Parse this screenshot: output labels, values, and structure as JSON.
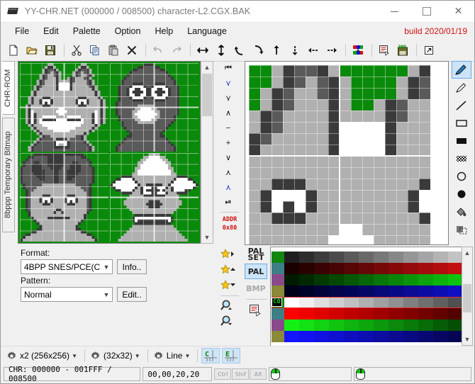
{
  "window": {
    "title": "YY-CHR.NET (000000 / 008500) character-L2.CGX.BAK",
    "icon": "chip-icon",
    "minimize": "minimize-icon",
    "maximize": "maximize-icon",
    "close": "close-icon"
  },
  "menu": {
    "items": [
      "File",
      "Edit",
      "Palette",
      "Option",
      "Help",
      "Language"
    ],
    "build": "build 2020/01/19"
  },
  "toolbar": {
    "groups": [
      [
        "new-file-icon",
        "open-file-icon",
        "save-file-icon"
      ],
      [
        "cut-icon",
        "copy-icon",
        "paste-icon",
        "delete-icon"
      ],
      [
        "undo-icon",
        "redo-icon"
      ],
      [
        "flip-horizontal-icon",
        "flip-vertical-icon",
        "rotate-left-icon",
        "rotate-right-icon"
      ],
      [
        "shift-up-icon",
        "shift-down-icon",
        "shift-left-icon",
        "shift-right-icon"
      ],
      [
        "rgb-palette-icon"
      ],
      [
        "palette-edit-icon"
      ],
      [
        "export-bmp-icon"
      ],
      [
        "open-external-icon"
      ]
    ]
  },
  "vtabs": {
    "items": [
      {
        "label": "CHR-ROM",
        "selected": true
      },
      {
        "label": "8bppp Temporary Bitmap",
        "selected": false
      }
    ]
  },
  "nav": {
    "buttons": [
      "page-first-icon",
      "page-up-fast-icon",
      "page-up-icon",
      "line-up-icon",
      "decrement-icon",
      "increment-icon",
      "line-down-icon",
      "page-down-icon",
      "page-down-fast-icon",
      "page-last-icon"
    ],
    "addr_label": "ADDR",
    "addr_value": "0x80"
  },
  "format": {
    "format_label": "Format:",
    "format_value": "4BPP SNES/PCE(C",
    "info_button": "Info..",
    "pattern_label": "Pattern:",
    "pattern_value": "Normal",
    "edit_button": "Edit.."
  },
  "stars": {
    "buttons": [
      "bookmark-goto-icon",
      "bookmark-prev-icon",
      "bookmark-next-icon"
    ],
    "zoom_in": "zoom-in-icon",
    "zoom_out": "zoom-out-icon"
  },
  "tools": {
    "items": [
      {
        "name": "pen-tool",
        "selected": true
      },
      {
        "name": "pencil-tool",
        "selected": false
      },
      {
        "name": "line-tool",
        "selected": false
      },
      {
        "name": "rectangle-outline-tool",
        "selected": false
      },
      {
        "name": "rectangle-filled-tool",
        "selected": false
      },
      {
        "name": "dither-tool",
        "selected": false
      },
      {
        "name": "ellipse-outline-tool",
        "selected": false
      },
      {
        "name": "ellipse-filled-tool",
        "selected": false
      },
      {
        "name": "fill-bucket-tool",
        "selected": false
      },
      {
        "name": "select-region-tool",
        "selected": false
      }
    ]
  },
  "palette": {
    "side_buttons": [
      {
        "label": "PAL\nSET",
        "name": "pal-set-button",
        "selected": false,
        "dim": false
      },
      {
        "label": "PAL",
        "name": "pal-button",
        "selected": true,
        "dim": false
      },
      {
        "label": "BMP",
        "name": "bmp-button",
        "selected": false,
        "dim": true
      }
    ],
    "palette_edit_icon": "palette-edit-icon",
    "selected_index_tag": "C0",
    "selected_row": 4,
    "first_column": [
      "#118611",
      "#3d7f86",
      "#8a4a8a",
      "#8a8a38",
      "#118611",
      "#3d7f86",
      "#8a4a8a",
      "#8a8a38"
    ],
    "rows": [
      {
        "name": "grayscale-ramp-ascending",
        "from": "#1e1e1e",
        "to": "#ffffff"
      },
      {
        "name": "red-ramp-ascending",
        "from": "#1a0000",
        "to": "#ff1414"
      },
      {
        "name": "green-ramp-ascending",
        "from": "#001a00",
        "to": "#14ff14"
      },
      {
        "name": "blue-ramp-ascending",
        "from": "#00001a",
        "to": "#1414ff"
      },
      {
        "name": "grayscale-ramp-descending",
        "from": "#ffffff",
        "to": "#111111"
      },
      {
        "name": "red-ramp-descending",
        "from": "#ff0000",
        "to": "#140000"
      },
      {
        "name": "green-ramp-descending",
        "from": "#14f014",
        "to": "#001400"
      },
      {
        "name": "blue-ramp-descending",
        "from": "#1414ff",
        "to": "#000014"
      }
    ]
  },
  "bottombar": {
    "zoom_select": "x2 (256x256)",
    "size_select": "(32x32)",
    "tool_select": "Line",
    "grid_buttons": [
      {
        "label": "C",
        "name": "chr-grid-toggle"
      },
      {
        "label": "E",
        "name": "editor-grid-toggle"
      }
    ]
  },
  "status": {
    "chr_range": "CHR: 000000 - 001FFF / 008500",
    "coords": "00,00,20,20",
    "modifier_keys": [
      "Ctrl",
      "Shif",
      "Alt"
    ],
    "mouse_left_icon": "mouse-icon",
    "mouse_right_icon": "mouse-icon"
  },
  "canvas": {
    "background_color": "#0a8a0a",
    "grid_color": "#d8d8d8",
    "tiles": [
      {
        "name": "tile-fox-character"
      },
      {
        "name": "tile-falcon-character"
      },
      {
        "name": "tile-human-character"
      },
      {
        "name": "tile-goat-character"
      }
    ],
    "editor_tile": "tile-fox-character-zoomed"
  }
}
